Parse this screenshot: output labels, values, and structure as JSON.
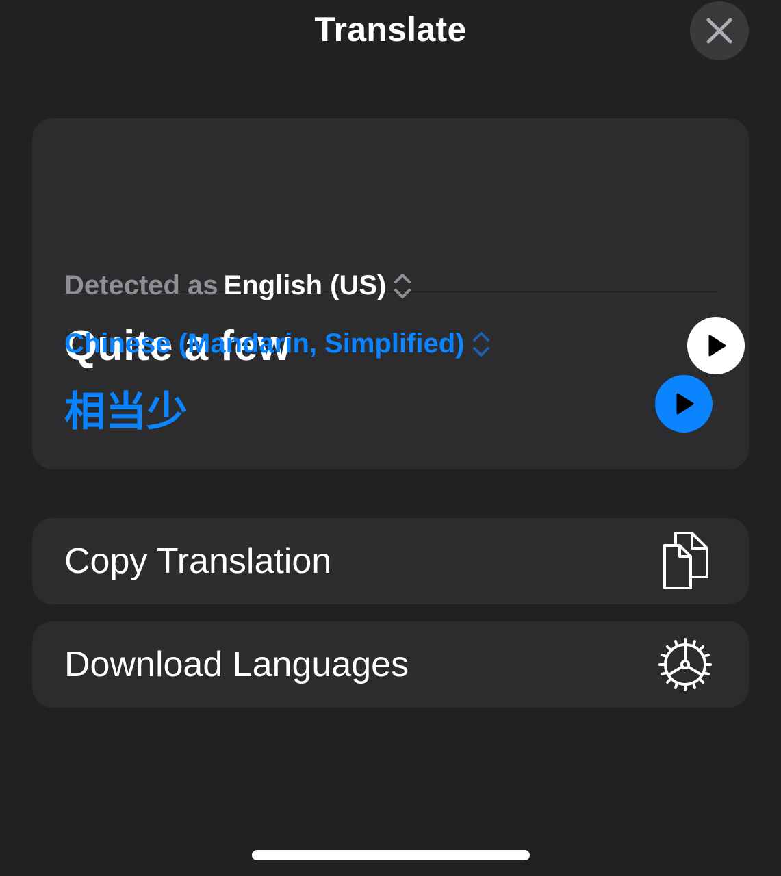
{
  "header": {
    "title": "Translate",
    "close_icon": "close-icon"
  },
  "translation": {
    "detected_label": "Detected as",
    "source_language": "English (US)",
    "source_text": "Quite a few",
    "target_language": "Chinese (Mandarin, Simplified)",
    "target_text": "相当少",
    "play_icon": "play-icon",
    "language_picker_icon": "chevron-up-down-icon"
  },
  "actions": {
    "copy_label": "Copy Translation",
    "copy_icon": "copy-icon",
    "download_label": "Download Languages",
    "download_icon": "gear-icon"
  },
  "colors": {
    "background": "#212121",
    "card": "#2c2c2e",
    "accent": "#0a84ff",
    "secondary_text": "#8e8e93"
  }
}
